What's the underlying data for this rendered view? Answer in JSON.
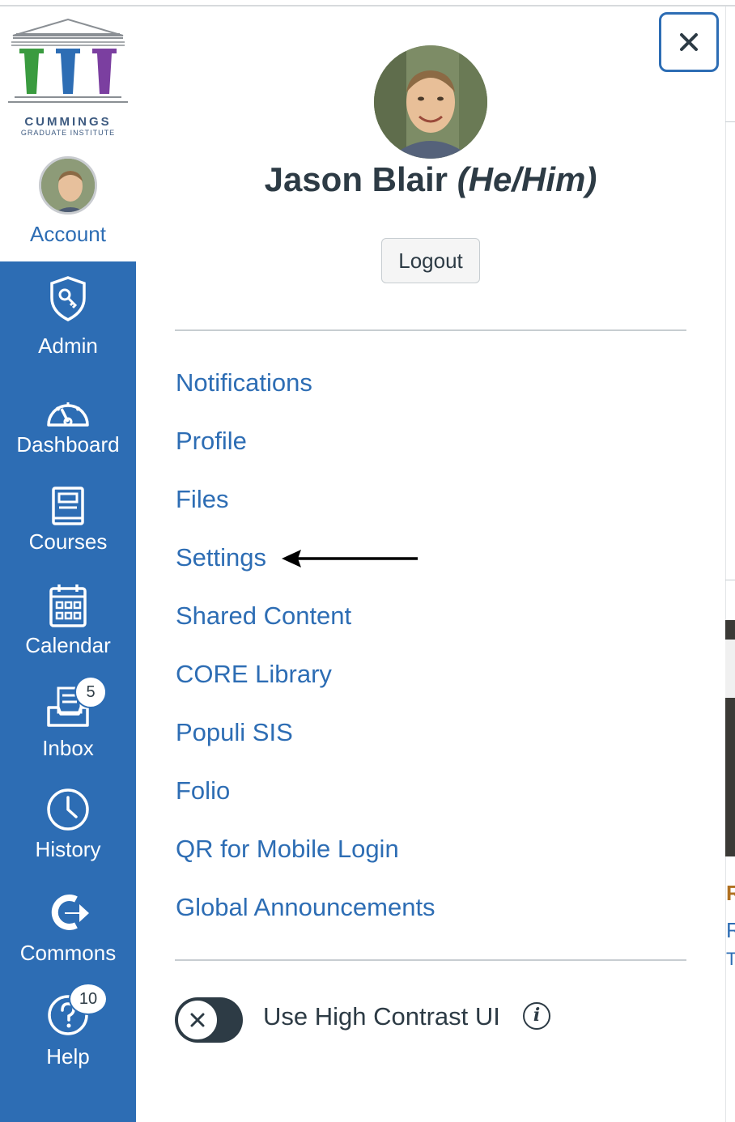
{
  "brand": {
    "logo_line1": "CUMMINGS",
    "logo_line2": "GRADUATE INSTITUTE",
    "column_colors": [
      "#3a9b3f",
      "#2d6db4",
      "#7b3fa0"
    ]
  },
  "nav": {
    "account_label": "Account",
    "items": [
      {
        "label": "Admin",
        "icon": "shield-key-icon"
      },
      {
        "label": "Dashboard",
        "icon": "speedometer-icon"
      },
      {
        "label": "Courses",
        "icon": "book-icon"
      },
      {
        "label": "Calendar",
        "icon": "calendar-icon"
      },
      {
        "label": "Inbox",
        "icon": "inbox-icon",
        "badge": "5"
      },
      {
        "label": "History",
        "icon": "clock-icon"
      },
      {
        "label": "Commons",
        "icon": "commons-arrow-icon"
      },
      {
        "label": "Help",
        "icon": "question-circle-icon",
        "badge": "10"
      }
    ],
    "accent_color": "#2d6db4"
  },
  "tray": {
    "user_name": "Jason Blair",
    "pronouns": "(He/Him)",
    "logout_label": "Logout",
    "close_icon": "close-x-icon",
    "links": [
      "Notifications",
      "Profile",
      "Files",
      "Settings",
      "Shared Content",
      "CORE Library",
      "Populi SIS",
      "Folio",
      "QR for Mobile Login",
      "Global Announcements"
    ],
    "high_contrast_label": "Use High Contrast UI",
    "high_contrast_enabled": false,
    "info_icon": "info-icon",
    "annotation": "arrow pointing to Settings"
  },
  "background": {
    "partial_chars": [
      "R",
      "R",
      "T"
    ]
  }
}
